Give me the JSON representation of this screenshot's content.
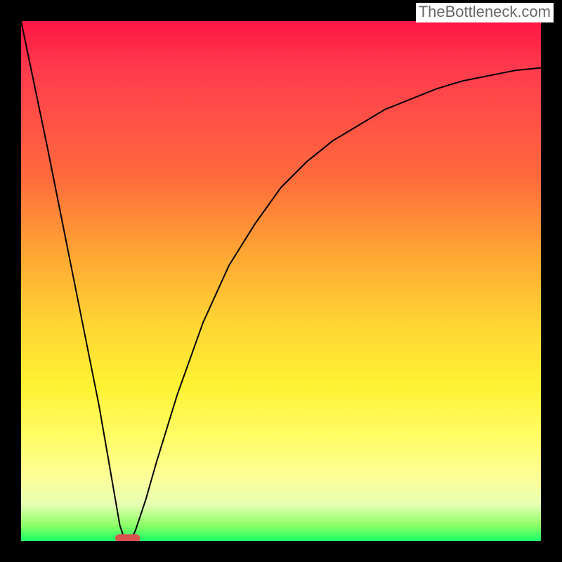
{
  "attribution": "TheBottleneck.com",
  "chart_data": {
    "type": "line",
    "title": "",
    "xlabel": "",
    "ylabel": "",
    "xlim": [
      0,
      100
    ],
    "ylim": [
      0,
      100
    ],
    "background_gradient": {
      "direction": "vertical",
      "stops": [
        {
          "pos": 0.0,
          "color": "#ff1744"
        },
        {
          "pos": 0.1,
          "color": "#ff3d4d"
        },
        {
          "pos": 0.3,
          "color": "#ff6a3c"
        },
        {
          "pos": 0.45,
          "color": "#ffa733"
        },
        {
          "pos": 0.58,
          "color": "#ffd433"
        },
        {
          "pos": 0.7,
          "color": "#fff233"
        },
        {
          "pos": 0.8,
          "color": "#fffc66"
        },
        {
          "pos": 0.88,
          "color": "#fcff99"
        },
        {
          "pos": 0.93,
          "color": "#e6ffb3"
        },
        {
          "pos": 0.97,
          "color": "#8cff66"
        },
        {
          "pos": 1.0,
          "color": "#1aff66"
        }
      ]
    },
    "series": [
      {
        "name": "bottleneck-curve",
        "color": "#000000",
        "stroke_width": 2,
        "x": [
          0,
          5,
          10,
          15,
          19,
          20,
          21,
          22,
          24,
          26,
          30,
          35,
          40,
          45,
          50,
          55,
          60,
          65,
          70,
          75,
          80,
          85,
          90,
          95,
          100
        ],
        "y": [
          100,
          76,
          51,
          26,
          3,
          0,
          0,
          2,
          8,
          15,
          28,
          42,
          53,
          61,
          68,
          73,
          77,
          80,
          83,
          85,
          87,
          88.5,
          89.5,
          90.5,
          91
        ]
      }
    ],
    "marker": {
      "name": "optimal-region",
      "shape": "rounded-rect",
      "color": "#d9534f",
      "cx": 20.5,
      "cy": 0.5,
      "rx": 2.4,
      "ry": 0.8
    }
  }
}
